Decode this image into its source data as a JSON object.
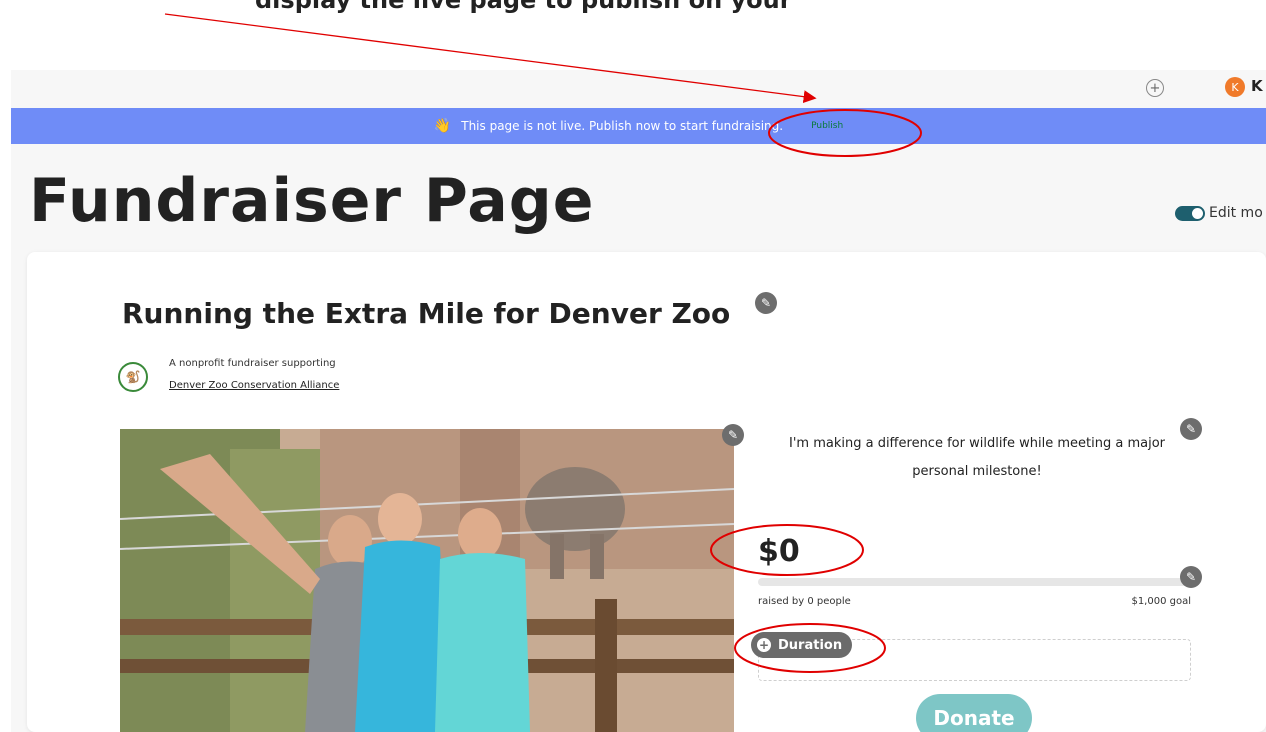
{
  "caption": {
    "text": "display the live page to publish on your "
  },
  "topbar": {
    "add_icon": "plus-circle-icon",
    "avatar_initial": "K",
    "user_name": "K"
  },
  "banner": {
    "icon": "waving-hand-icon",
    "message": "This page is not live. Publish now to start fundraising.",
    "publish_label": "Publish"
  },
  "page": {
    "title": "Fundraiser Page",
    "edit_mode_label": "Edit mo"
  },
  "campaign": {
    "title": "Running the Extra Mile for Denver Zoo",
    "org_intro": "A nonprofit fundraiser supporting",
    "org_name": "Denver Zoo Conservation Alliance",
    "story": "I'm making a difference for wildlife while meeting a major personal milestone!",
    "raised_amount": "$0",
    "raised_by": "raised by 0 people",
    "goal": "$1,000 goal",
    "progress_fraction": 0,
    "duration_label": "Duration",
    "donate_label": "Donate"
  },
  "colors": {
    "banner": "#6f8cf7",
    "accent": "#1e5f6e",
    "donate": "#7ec6c6",
    "annotation": "#e00000"
  }
}
